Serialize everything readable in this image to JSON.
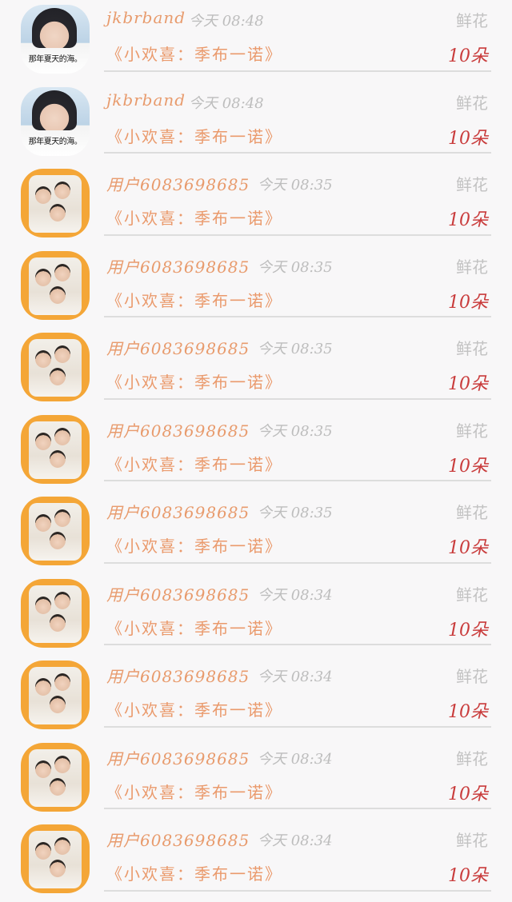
{
  "rows": [
    {
      "avatar": "girl",
      "avatar_caption": "那年夏天的海。",
      "user": "jkbrband",
      "time": "今天 08:48",
      "gift": "《小欢喜：季布一诺》",
      "type": "鲜花",
      "count": "10朵"
    },
    {
      "avatar": "girl",
      "avatar_caption": "那年夏天的海。",
      "user": "jkbrband",
      "time": "今天 08:48",
      "gift": "《小欢喜：季布一诺》",
      "type": "鲜花",
      "count": "10朵"
    },
    {
      "avatar": "boys",
      "user": "用户6083698685",
      "time": "今天 08:35",
      "gift": "《小欢喜：季布一诺》",
      "type": "鲜花",
      "count": "10朵"
    },
    {
      "avatar": "boys",
      "user": "用户6083698685",
      "time": "今天 08:35",
      "gift": "《小欢喜：季布一诺》",
      "type": "鲜花",
      "count": "10朵"
    },
    {
      "avatar": "boys",
      "user": "用户6083698685",
      "time": "今天 08:35",
      "gift": "《小欢喜：季布一诺》",
      "type": "鲜花",
      "count": "10朵"
    },
    {
      "avatar": "boys",
      "user": "用户6083698685",
      "time": "今天 08:35",
      "gift": "《小欢喜：季布一诺》",
      "type": "鲜花",
      "count": "10朵"
    },
    {
      "avatar": "boys",
      "user": "用户6083698685",
      "time": "今天 08:35",
      "gift": "《小欢喜：季布一诺》",
      "type": "鲜花",
      "count": "10朵"
    },
    {
      "avatar": "boys",
      "user": "用户6083698685",
      "time": "今天 08:34",
      "gift": "《小欢喜：季布一诺》",
      "type": "鲜花",
      "count": "10朵"
    },
    {
      "avatar": "boys",
      "user": "用户6083698685",
      "time": "今天 08:34",
      "gift": "《小欢喜：季布一诺》",
      "type": "鲜花",
      "count": "10朵"
    },
    {
      "avatar": "boys",
      "user": "用户6083698685",
      "time": "今天 08:34",
      "gift": "《小欢喜：季布一诺》",
      "type": "鲜花",
      "count": "10朵"
    },
    {
      "avatar": "boys",
      "user": "用户6083698685",
      "time": "今天 08:34",
      "gift": "《小欢喜：季布一诺》",
      "type": "鲜花",
      "count": "10朵"
    }
  ]
}
